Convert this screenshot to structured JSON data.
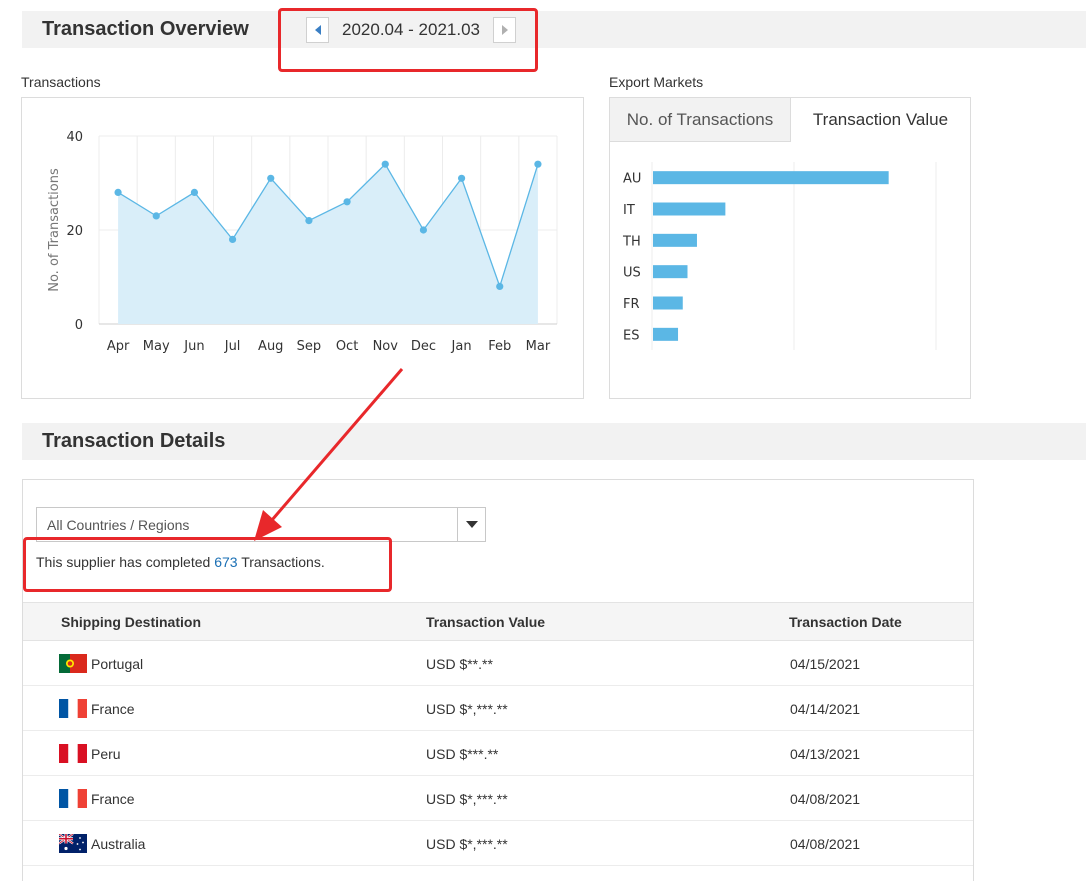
{
  "overview": {
    "title": "Transaction Overview",
    "date_range": "2020.04 - 2021.03",
    "prev_icon": "triangle-left-icon",
    "next_icon": "triangle-right-icon"
  },
  "transactions_panel": {
    "label": "Transactions"
  },
  "markets_panel": {
    "label": "Export Markets",
    "tabs": [
      {
        "label": "No. of Transactions",
        "active": false
      },
      {
        "label": "Transaction Value",
        "active": true
      }
    ]
  },
  "chart_data": [
    {
      "type": "area",
      "ylabel": "No. of Transactions",
      "ylim": [
        0,
        40
      ],
      "yticks": [
        0,
        20,
        40
      ],
      "grid": true,
      "x": [
        "Apr",
        "May",
        "Jun",
        "Jul",
        "Aug",
        "Sep",
        "Oct",
        "Nov",
        "Dec",
        "Jan",
        "Feb",
        "Mar"
      ],
      "y": [
        28,
        23,
        28,
        18,
        31,
        22,
        26,
        34,
        20,
        31,
        8,
        34
      ],
      "color": "#5bb7e5",
      "fill": "#d9eef9"
    },
    {
      "type": "bar",
      "orientation": "horizontal",
      "categories": [
        "AU",
        "IT",
        "TH",
        "US",
        "FR",
        "ES"
      ],
      "values": [
        100,
        31,
        19,
        15,
        13,
        11
      ],
      "xlim": [
        0,
        120
      ],
      "grid": true,
      "color": "#5bb7e5"
    }
  ],
  "details": {
    "title": "Transaction Details",
    "filter": {
      "selected": "All Countries / Regions",
      "arrow_icon": "caret-down-icon"
    },
    "summary": {
      "prefix": "This supplier has completed ",
      "count": "673",
      "suffix": " Transactions."
    },
    "columns": [
      "Shipping Destination",
      "Transaction Value",
      "Transaction Date"
    ],
    "rows": [
      {
        "flag_icon": "flag-portugal-icon",
        "country": "Portugal",
        "value": "USD $**.**",
        "date": "04/15/2021"
      },
      {
        "flag_icon": "flag-france-icon",
        "country": "France",
        "value": "USD $*,***.**",
        "date": "04/14/2021"
      },
      {
        "flag_icon": "flag-peru-icon",
        "country": "Peru",
        "value": "USD $***.**",
        "date": "04/13/2021"
      },
      {
        "flag_icon": "flag-france-icon",
        "country": "France",
        "value": "USD $*,***.**",
        "date": "04/08/2021"
      },
      {
        "flag_icon": "flag-australia-icon",
        "country": "Australia",
        "value": "USD $*,***.**",
        "date": "04/08/2021"
      }
    ]
  },
  "colors": {
    "annotation": "#e8282b",
    "link": "#1a6fb4",
    "accent": "#5bb7e5",
    "nav_arrow": "#3a7fc4"
  }
}
